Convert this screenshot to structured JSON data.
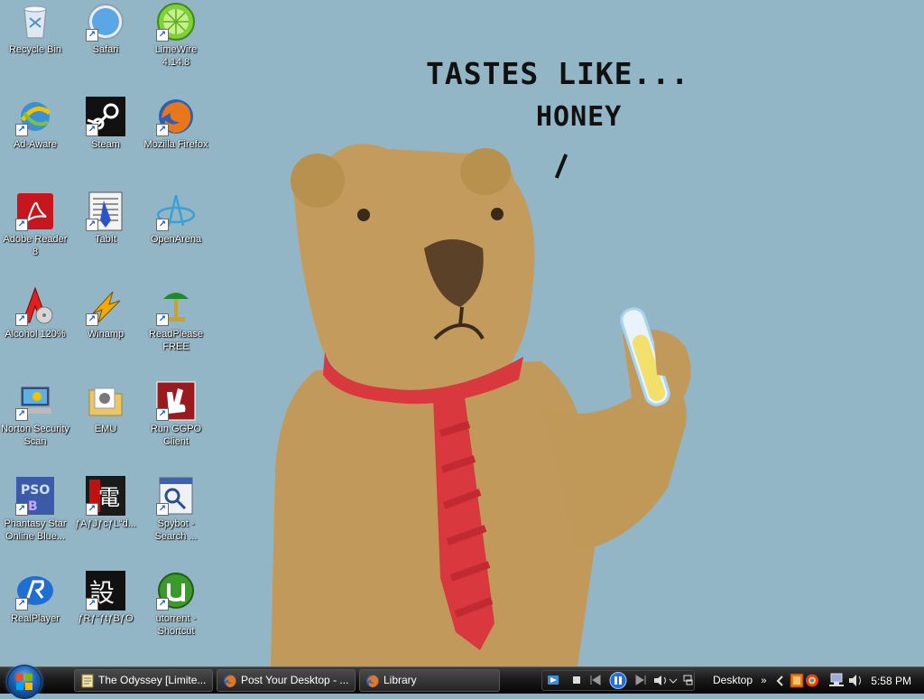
{
  "wallpaper": {
    "caption_line1": "TASTES LIKE...",
    "caption_line2": "HONEY",
    "colors": {
      "background": "#93b6c6",
      "bear": "#c19a5b",
      "tie": "#d8383e",
      "liquid": "#f1e06a"
    }
  },
  "desktop_icons": [
    {
      "label": "Recycle Bin",
      "icon": "recycle-bin-icon",
      "shortcut": false
    },
    {
      "label": "Safari",
      "icon": "safari-icon",
      "shortcut": true
    },
    {
      "label": "LimeWire 4.14.8",
      "icon": "limewire-icon",
      "shortcut": true
    },
    {
      "label": "Ad-Aware",
      "icon": "ad-aware-icon",
      "shortcut": true
    },
    {
      "label": "Steam",
      "icon": "steam-icon",
      "shortcut": true
    },
    {
      "label": "Mozilla Firefox",
      "icon": "firefox-icon",
      "shortcut": true
    },
    {
      "label": "Adobe Reader 8",
      "icon": "adobe-reader-icon",
      "shortcut": true
    },
    {
      "label": "TabIt",
      "icon": "tabit-icon",
      "shortcut": true
    },
    {
      "label": "OpenArena",
      "icon": "openarena-icon",
      "shortcut": true
    },
    {
      "label": "Alcohol 120%",
      "icon": "alcohol-icon",
      "shortcut": true
    },
    {
      "label": "Winamp",
      "icon": "winamp-icon",
      "shortcut": true
    },
    {
      "label": "ReadPlease FREE",
      "icon": "readplease-icon",
      "shortcut": true
    },
    {
      "label": "Norton Security Scan",
      "icon": "norton-icon",
      "shortcut": true
    },
    {
      "label": "EMU",
      "icon": "folder-icon",
      "shortcut": false
    },
    {
      "label": "Run GGPO Client",
      "icon": "ggpo-icon",
      "shortcut": true
    },
    {
      "label": "Phantasy Star Online Blue...",
      "icon": "pso-icon",
      "shortcut": true
    },
    {
      "label": "ƒAƒJƒcƒL“d...",
      "icon": "game-icon",
      "shortcut": true
    },
    {
      "label": "Spybot - Search ...",
      "icon": "spybot-icon",
      "shortcut": true
    },
    {
      "label": "RealPlayer",
      "icon": "realplayer-icon",
      "shortcut": true
    },
    {
      "label": "ƒRƒ“ƒtƒBƒO",
      "icon": "config-icon",
      "shortcut": true
    },
    {
      "label": "utorrent - Shortcut",
      "icon": "utorrent-icon",
      "shortcut": true
    }
  ],
  "taskbar": {
    "buttons": [
      {
        "label": "The Odyssey [Limite...",
        "icon": "document-icon"
      },
      {
        "label": "Post Your Desktop - ...",
        "icon": "firefox-icon"
      },
      {
        "label": "Library",
        "icon": "firefox-icon"
      }
    ],
    "desktop_toolbar_label": "Desktop",
    "expand_glyph": "»",
    "clock": "5:58 PM"
  }
}
